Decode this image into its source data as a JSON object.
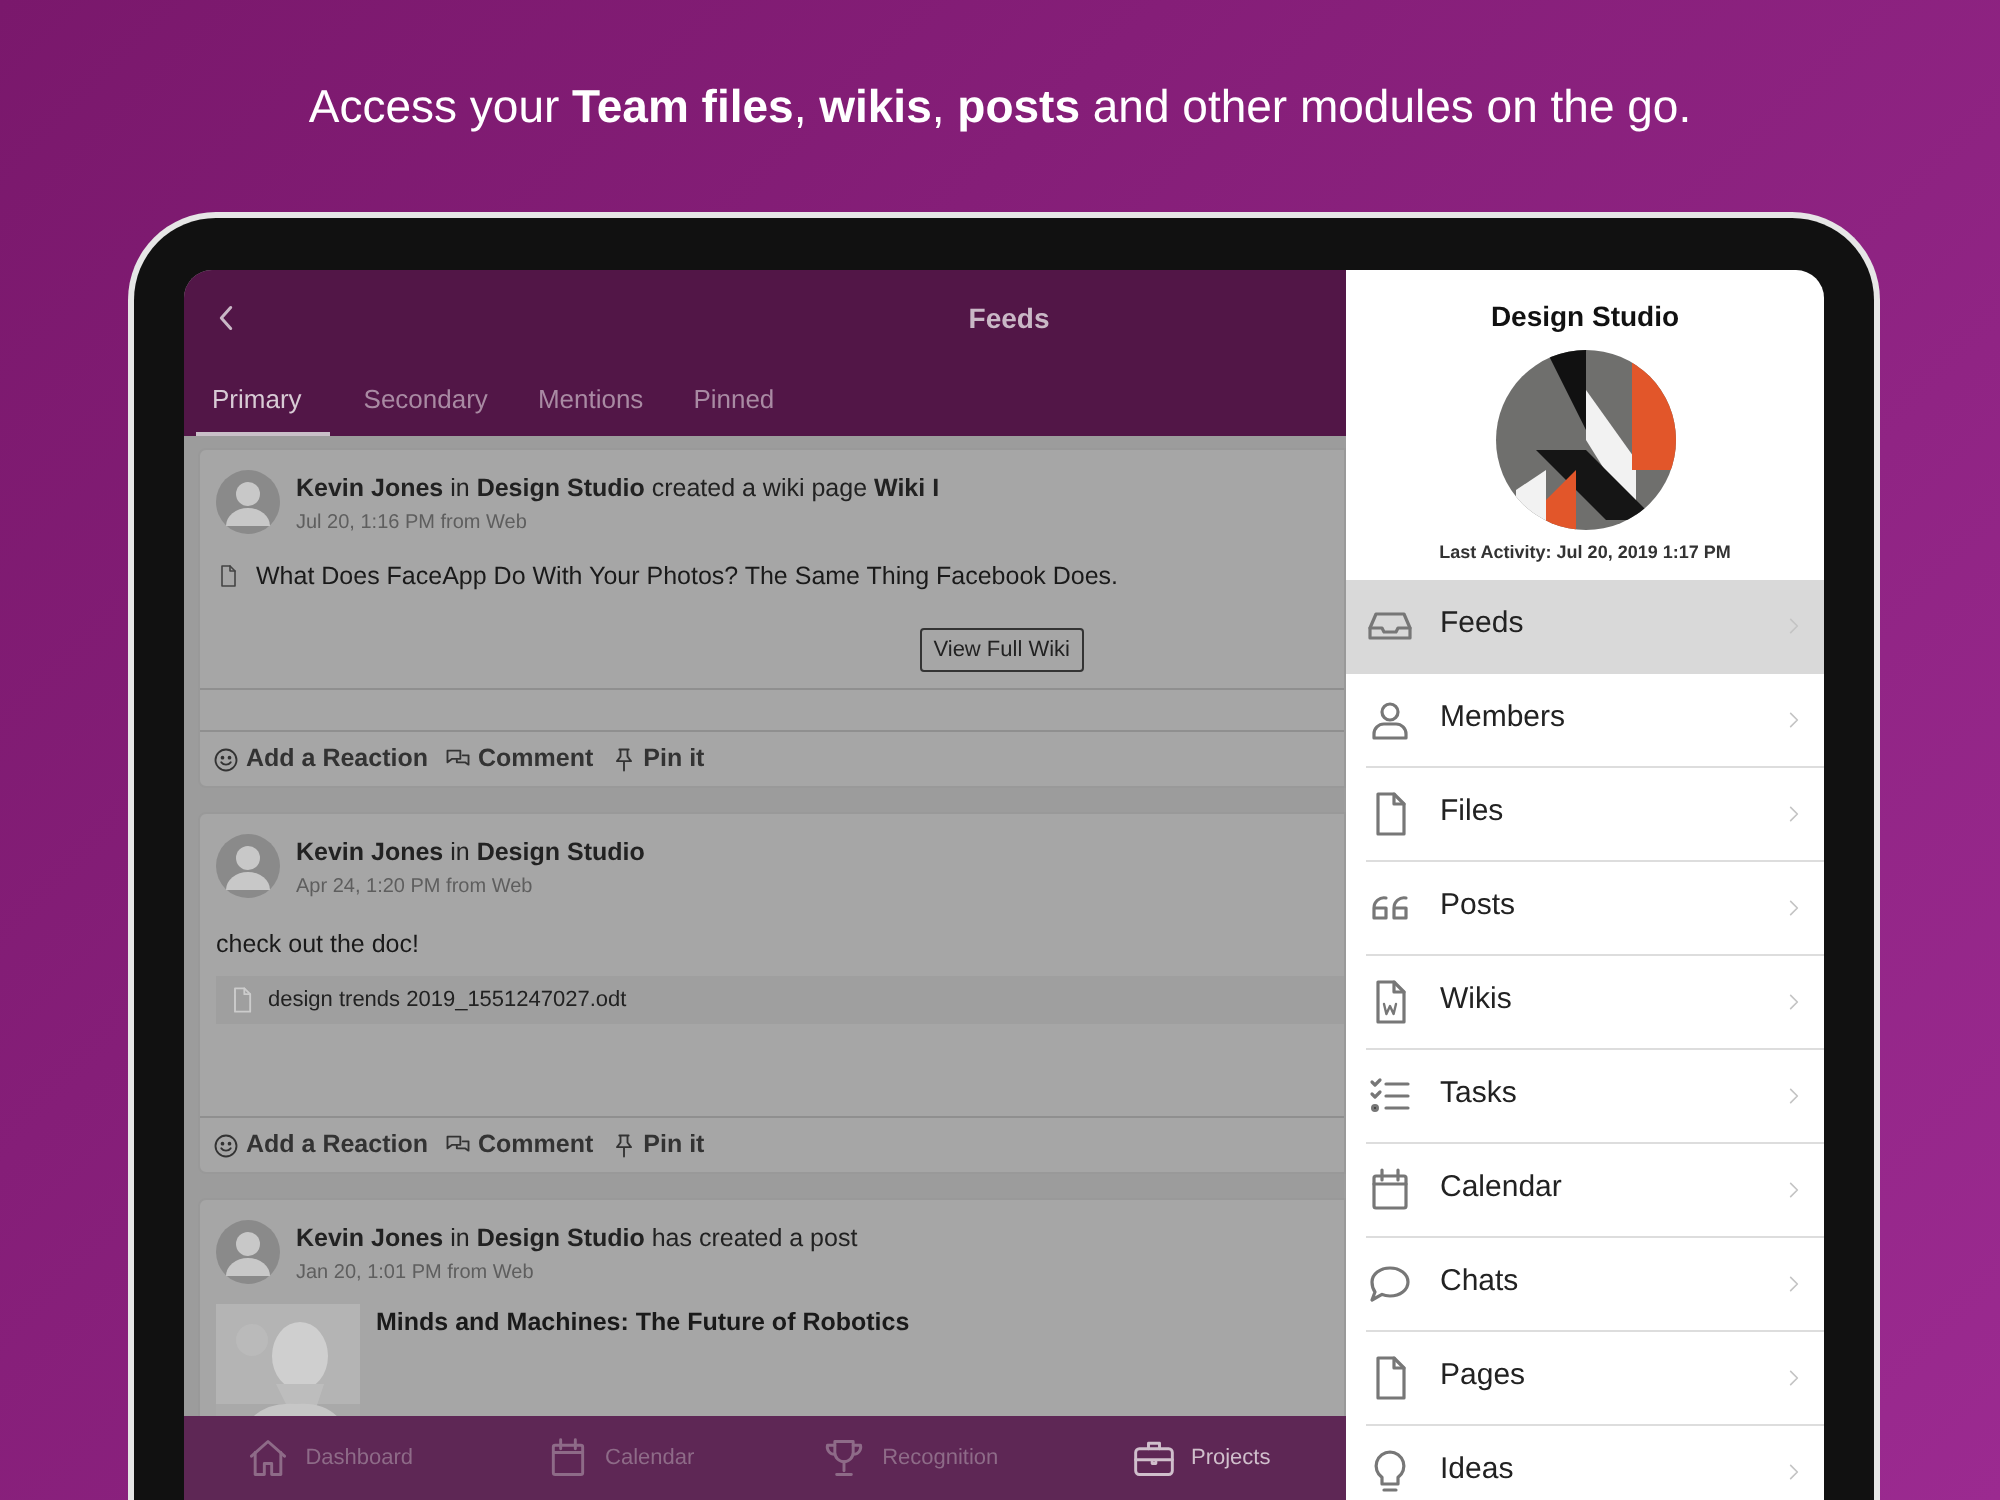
{
  "headline": "Access your **Team files**, **wikis**, **posts** and other modules on the go.",
  "feed_screen": {
    "title": "Feeds",
    "tabs": [
      {
        "label": "Primary",
        "selected": true
      },
      {
        "label": "Secondary",
        "selected": false
      },
      {
        "label": "Mentions",
        "selected": false
      },
      {
        "label": "Pinned",
        "selected": false
      }
    ],
    "posts": [
      {
        "kind": "wiki",
        "header": "**Kevin Jones** in **Design Studio** created a wiki page **Wiki I**",
        "meta": "Jul 20, 1:16 PM from Web",
        "wiki_title": "What Does FaceApp Do With Your Photos? The Same Thing Facebook Does.",
        "button": "View Full Wiki",
        "actions": [
          {
            "kind": "reaction",
            "label": "Add a Reaction"
          },
          {
            "kind": "comment",
            "label": "Comment"
          },
          {
            "kind": "pin",
            "label": "Pin it"
          }
        ]
      },
      {
        "kind": "attachment",
        "header": "**Kevin Jones** in **Design Studio**",
        "meta": "Apr 24, 1:20 PM from Web",
        "body": "check out the doc!",
        "file": "design trends 2019_1551247027.odt",
        "actions": [
          {
            "kind": "reaction",
            "label": "Add a Reaction"
          },
          {
            "kind": "comment",
            "label": "Comment"
          },
          {
            "kind": "pin",
            "label": "Pin it"
          }
        ]
      },
      {
        "kind": "article",
        "header": "**Kevin Jones** in **Design Studio** has created a post",
        "meta": "Jan 20, 1:01 PM from Web",
        "article_title": "Minds and Machines: The Future of Robotics"
      }
    ],
    "bottom_tabs": [
      {
        "kind": "home",
        "label": "Dashboard",
        "selected": false
      },
      {
        "kind": "calendar",
        "label": "Calendar",
        "selected": false
      },
      {
        "kind": "trophy",
        "label": "Recognition",
        "selected": false
      },
      {
        "kind": "briefcase",
        "label": "Projects",
        "selected": true
      }
    ]
  },
  "group_panel": {
    "title": "Design Studio",
    "last_activity": "Last Activity: Jul 20, 2019 1:17 PM",
    "menu": [
      {
        "kind": "inbox",
        "label": "Feeds",
        "selected": true
      },
      {
        "kind": "person",
        "label": "Members",
        "selected": false
      },
      {
        "kind": "file",
        "label": "Files",
        "selected": false
      },
      {
        "kind": "quote",
        "label": "Posts",
        "selected": false
      },
      {
        "kind": "wiki",
        "label": "Wikis",
        "selected": false
      },
      {
        "kind": "tasks",
        "label": "Tasks",
        "selected": false
      },
      {
        "kind": "calendar",
        "label": "Calendar",
        "selected": false
      },
      {
        "kind": "chat",
        "label": "Chats",
        "selected": false
      },
      {
        "kind": "page",
        "label": "Pages",
        "selected": false
      },
      {
        "kind": "bulb",
        "label": "Ideas",
        "selected": false
      }
    ]
  }
}
